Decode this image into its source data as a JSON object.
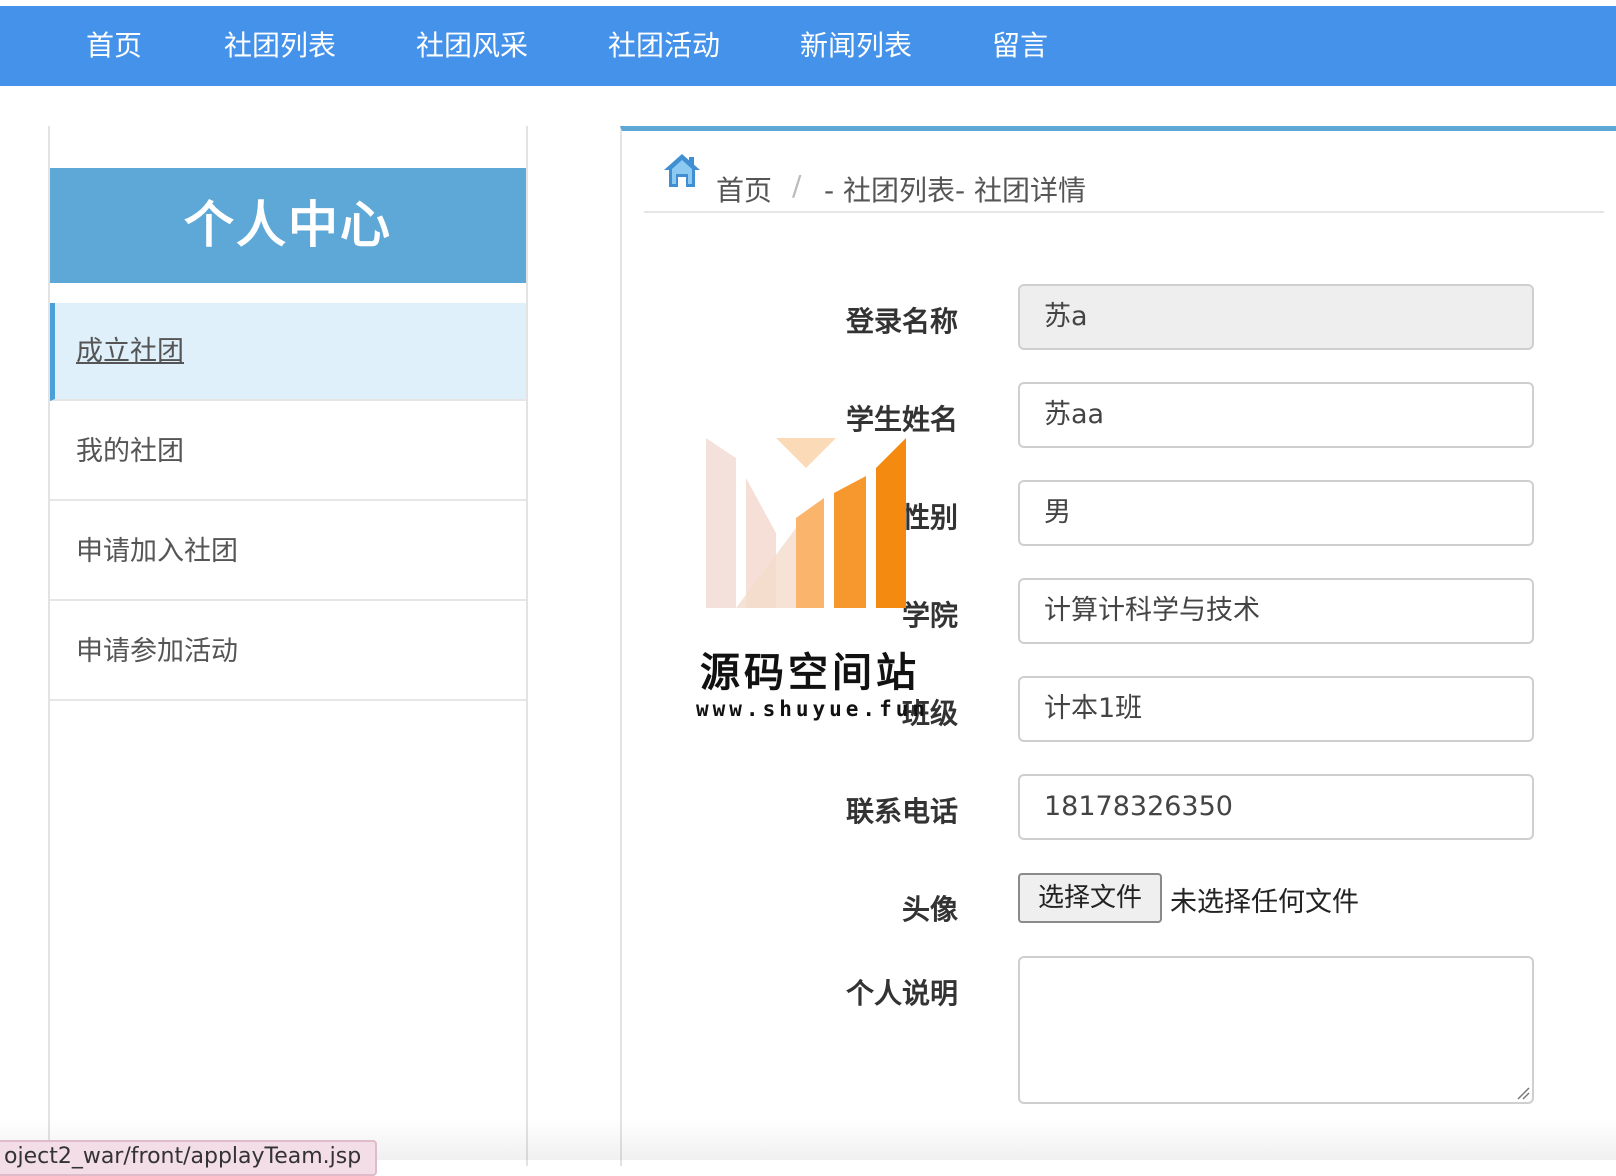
{
  "nav": {
    "items": [
      "首页",
      "社团列表",
      "社团风采",
      "社团活动",
      "新闻列表",
      "留言"
    ]
  },
  "sidebar": {
    "title": "个人中心",
    "items": [
      {
        "label": "成立社团",
        "active": true
      },
      {
        "label": "我的社团",
        "active": false
      },
      {
        "label": "申请加入社团",
        "active": false
      },
      {
        "label": "申请参加活动",
        "active": false
      }
    ]
  },
  "breadcrumb": {
    "home": "首页",
    "separator": "/",
    "path": "- 社团列表- 社团详情"
  },
  "form": {
    "login_name_label": "登录名称",
    "login_name_value": "苏a",
    "student_name_label": "学生姓名",
    "student_name_value": "苏aa",
    "gender_label": "性别",
    "gender_value": "男",
    "college_label": "学院",
    "college_value": "计算计科学与技术",
    "class_label": "班级",
    "class_value": "计本1班",
    "phone_label": "联系电话",
    "phone_value": "18178326350",
    "avatar_label": "头像",
    "file_button": "选择文件",
    "file_status": "未选择任何文件",
    "bio_label": "个人说明",
    "bio_value": ""
  },
  "watermark": {
    "title": "源码空间站",
    "url": "www.shuyue.fun"
  },
  "status_bar": {
    "url": "oject2_war/front/applayTeam.jsp"
  },
  "colors": {
    "topbar": "#4592ea",
    "sidebar_header": "#5ea8d8",
    "active_item_bg": "#dff0fb",
    "accent": "#4aa0d8"
  }
}
